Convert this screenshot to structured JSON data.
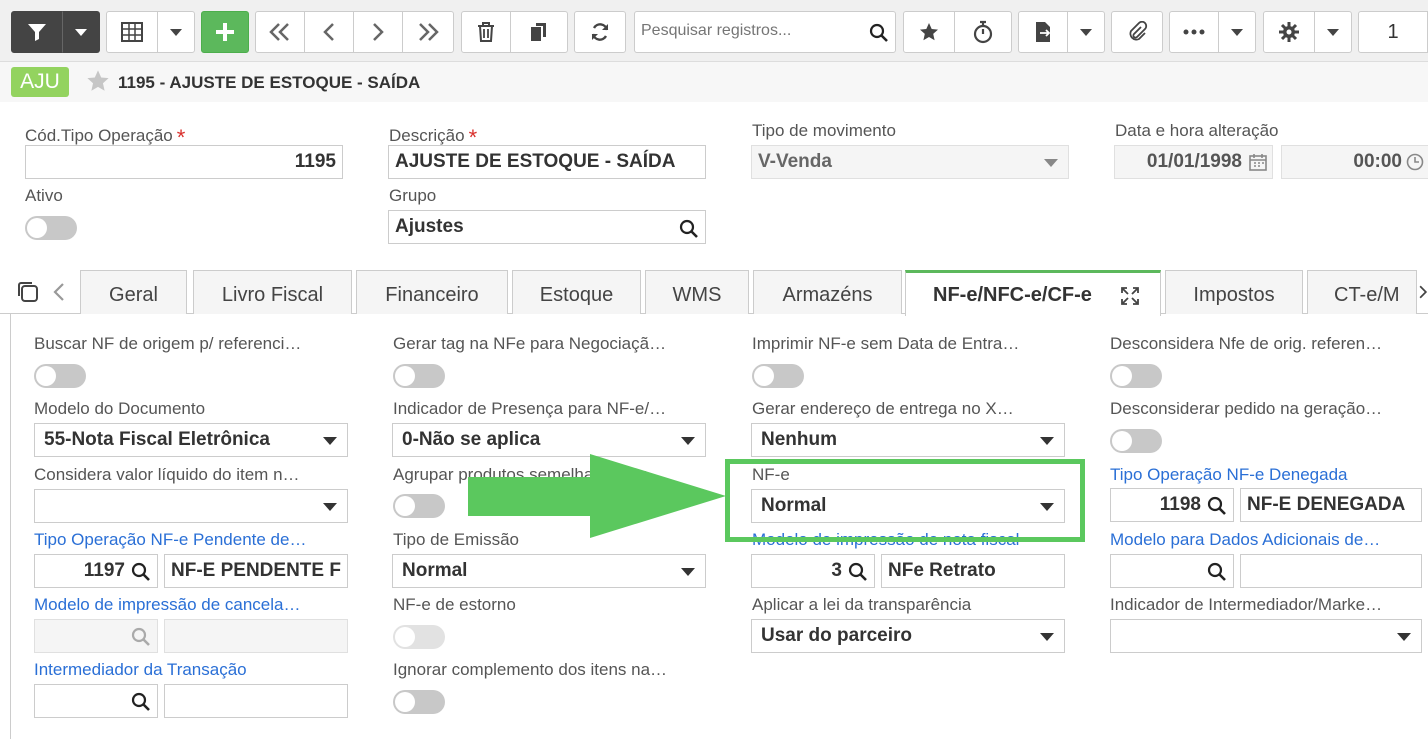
{
  "toolbar": {
    "search_placeholder": "Pesquisar registros...",
    "page": "1"
  },
  "header": {
    "badge": "AJU",
    "title": "1195 - AJUSTE DE ESTOQUE - SAÍDA"
  },
  "form": {
    "cod_label": "Cód.Tipo Operação",
    "cod_value": "1195",
    "desc_label": "Descrição",
    "desc_value": "AJUSTE DE ESTOQUE - SAÍDA",
    "tipo_mov_label": "Tipo de movimento",
    "tipo_mov_value": "V-Venda",
    "data_label": "Data e hora alteração",
    "data_value": "01/01/1998",
    "hora_value": "00:00",
    "ativo_label": "Ativo",
    "grupo_label": "Grupo",
    "grupo_value": "Ajustes"
  },
  "tabs": [
    "Geral",
    "Livro Fiscal",
    "Financeiro",
    "Estoque",
    "WMS",
    "Armazéns",
    "NF-e/NFC-e/CF-e",
    "Impostos",
    "CT-e/M"
  ],
  "panel": {
    "c1": {
      "buscar_nf": "Buscar NF de origem p/ referenci…",
      "modelo_doc_label": "Modelo do Documento",
      "modelo_doc_value": "55-Nota Fiscal Eletrônica",
      "considera_label": "Considera valor líquido do item n…",
      "pendente_label": "Tipo Operação NF-e Pendente de…",
      "pendente_code": "1197",
      "pendente_name": "NF-E PENDENTE F",
      "cancel_label": "Modelo de impressão de cancela…",
      "intermed_label": "Intermediador da Transação"
    },
    "c2": {
      "gerar_tag": "Gerar tag na NFe para Negociaçã…",
      "presenca_label": "Indicador de Presença para NF-e/…",
      "presenca_value": "0-Não se aplica",
      "agrupar_label": "Agrupar produtos semelhantes na…",
      "emissao_label": "Tipo de Emissão",
      "emissao_value": "Normal",
      "estorno_label": "NF-e de estorno",
      "ignorar_label": "Ignorar complemento dos itens na…"
    },
    "c3": {
      "imprimir_label": "Imprimir NF-e sem Data de Entra…",
      "gerar_end_label": "Gerar endereço de entrega no X…",
      "gerar_end_value": "Nenhum",
      "nfe_label": "NF-e",
      "nfe_value": "Normal",
      "modelo_impr_label": "Modelo de impressão de nota fiscal",
      "modelo_impr_code": "3",
      "modelo_impr_name": "NFe Retrato",
      "transp_label": "Aplicar a lei da transparência",
      "transp_value": "Usar do parceiro"
    },
    "c4": {
      "desconsidera_label": "Desconsidera Nfe de orig. referen…",
      "desconsiderar_ped_label": "Desconsiderar pedido na geração…",
      "denegada_label": "Tipo Operação NF-e Denegada",
      "denegada_code": "1198",
      "denegada_name": "NF-E DENEGADA",
      "dados_adic_label": "Modelo para Dados Adicionais de…",
      "ind_intermed_label": "Indicador de Intermediador/Marke…"
    }
  },
  "colors": {
    "accent_green": "#5cb85c",
    "highlight_green": "#5bc85e",
    "link_blue": "#2a6fd6",
    "badge_green": "#93d35f"
  }
}
